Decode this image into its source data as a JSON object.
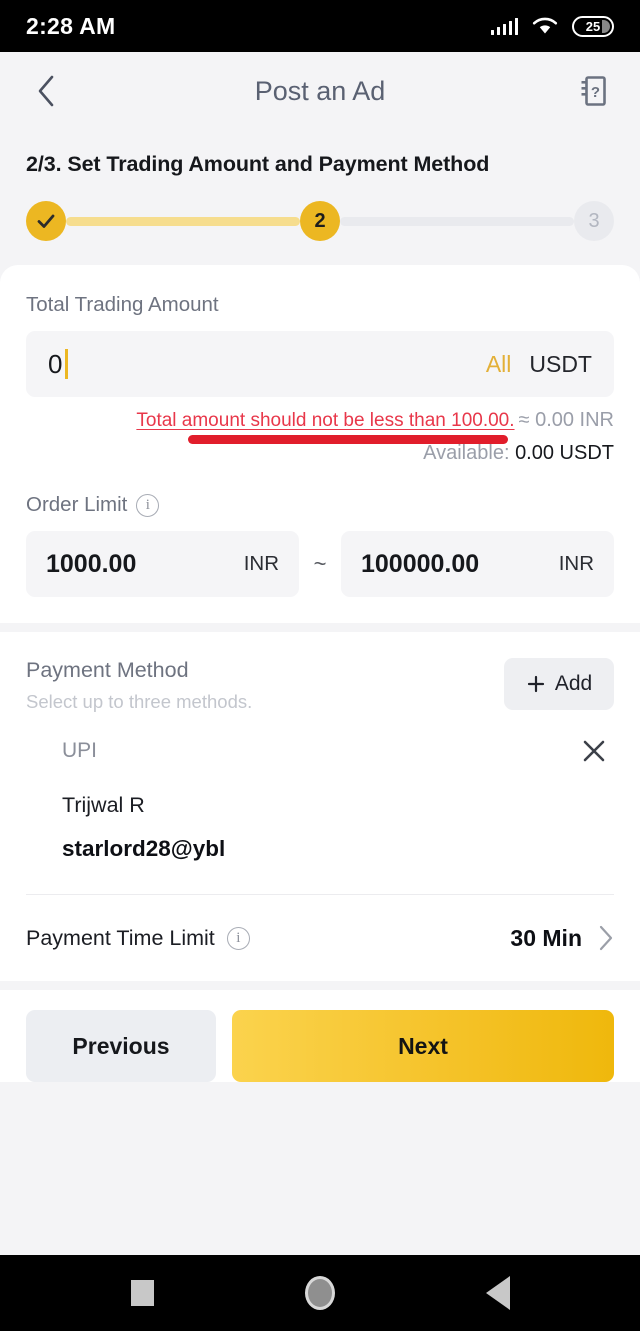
{
  "status_bar": {
    "time": "2:28 AM",
    "battery_percent": "25",
    "signal_icon": "signal-bars-icon",
    "wifi_icon": "wifi-icon",
    "battery_icon": "battery-icon"
  },
  "header": {
    "title": "Post an Ad",
    "back_icon": "chevron-left-icon",
    "help_icon": "help-guide-icon"
  },
  "step_heading": "2/3. Set Trading Amount and Payment Method",
  "stepper": {
    "step1": "✓",
    "step2": "2",
    "step3": "3",
    "active_color": "#ecb722",
    "fill_color": "#f6dd8e",
    "empty_color": "#e9eaee"
  },
  "trading_amount": {
    "label": "Total Trading Amount",
    "value": "0",
    "all_label": "All",
    "currency": "USDT",
    "error": "Total amount should not be less than 100.00.",
    "error_color": "#e8374a",
    "approx": "≈ 0.00 INR",
    "available_label": "Available:",
    "available_value": "0.00 USDT",
    "annotation_color": "#e11d2b"
  },
  "order_limit": {
    "label": "Order Limit",
    "info_icon": "info-icon",
    "min_value": "1000.00",
    "min_currency": "INR",
    "separator": "~",
    "max_value": "100000.00",
    "max_currency": "INR"
  },
  "payment_method": {
    "title": "Payment Method",
    "subtitle": "Select up to three methods.",
    "add_label": "Add",
    "add_icon": "plus-icon",
    "methods": [
      {
        "type": "UPI",
        "name": "Trijwal R",
        "account": "starlord28@ybl",
        "remove_icon": "close-icon"
      }
    ]
  },
  "payment_time_limit": {
    "label": "Payment Time Limit",
    "info_icon": "info-icon",
    "value": "30 Min",
    "chevron_icon": "chevron-right-icon"
  },
  "footer": {
    "previous_label": "Previous",
    "next_label": "Next",
    "next_color": "#f5c32a"
  },
  "navbar": {
    "recents_icon": "square-recents-icon",
    "home_icon": "circle-home-icon",
    "back_icon": "triangle-back-icon"
  }
}
